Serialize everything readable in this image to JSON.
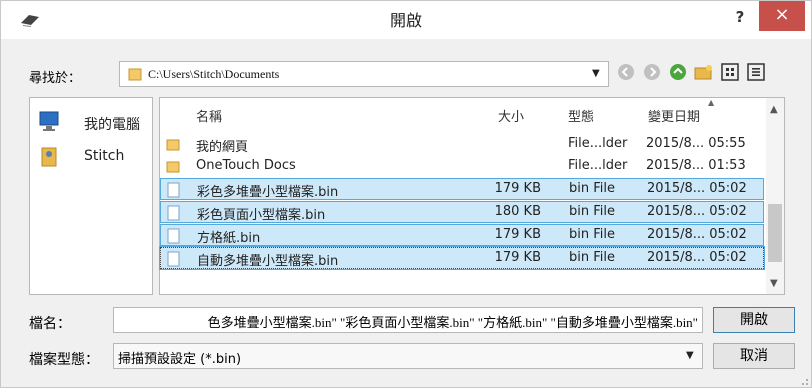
{
  "window": {
    "title": "開啟",
    "help_label": "?",
    "close_label": "×"
  },
  "toolbar": {
    "look_in_label": "尋找於：",
    "path": "C:\\Users\\Stitch\\Documents",
    "view_buttons": [
      "back-icon",
      "forward-icon",
      "up-folder-icon",
      "new-folder-icon",
      "view-grid-icon",
      "view-details-icon"
    ]
  },
  "places": [
    {
      "label": "我的電腦",
      "icon": "computer-icon"
    },
    {
      "label": "Stitch",
      "icon": "user-folder-icon"
    }
  ],
  "columns": {
    "name": "名稱",
    "size": "大小",
    "type": "型態",
    "modified": "變更日期"
  },
  "files": [
    {
      "name": "我的網頁",
      "size": "",
      "type": "File...lder",
      "modified": "2015/8... 05:55",
      "kind": "folder",
      "selected": false
    },
    {
      "name": "OneTouch Docs",
      "size": "",
      "type": "File...lder",
      "modified": "2015/8... 01:53",
      "kind": "folder",
      "selected": false
    },
    {
      "name": "彩色多堆疊小型檔案.bin",
      "size": "179 KB",
      "type": "bin File",
      "modified": "2015/8... 05:02",
      "kind": "file",
      "selected": true
    },
    {
      "name": "彩色頁面小型檔案.bin",
      "size": "180 KB",
      "type": "bin File",
      "modified": "2015/8... 05:02",
      "kind": "file",
      "selected": true
    },
    {
      "name": "方格紙.bin",
      "size": "179 KB",
      "type": "bin File",
      "modified": "2015/8... 05:02",
      "kind": "file",
      "selected": true
    },
    {
      "name": "自動多堆疊小型檔案.bin",
      "size": "179 KB",
      "type": "bin File",
      "modified": "2015/8... 05:02",
      "kind": "file",
      "selected": true
    }
  ],
  "filename": {
    "label": "檔名：",
    "value": "色多堆疊小型檔案.bin\" \"彩色頁面小型檔案.bin\" \"方格紙.bin\" \"自動多堆疊小型檔案.bin\""
  },
  "filetype": {
    "label": "檔案型態：",
    "value": "掃描預設設定 (*.bin)"
  },
  "buttons": {
    "open": "開啟",
    "cancel": "取消"
  },
  "colors": {
    "selection": "#cde8f8",
    "selection_border": "#56a9dc",
    "close": "#c7504b"
  }
}
